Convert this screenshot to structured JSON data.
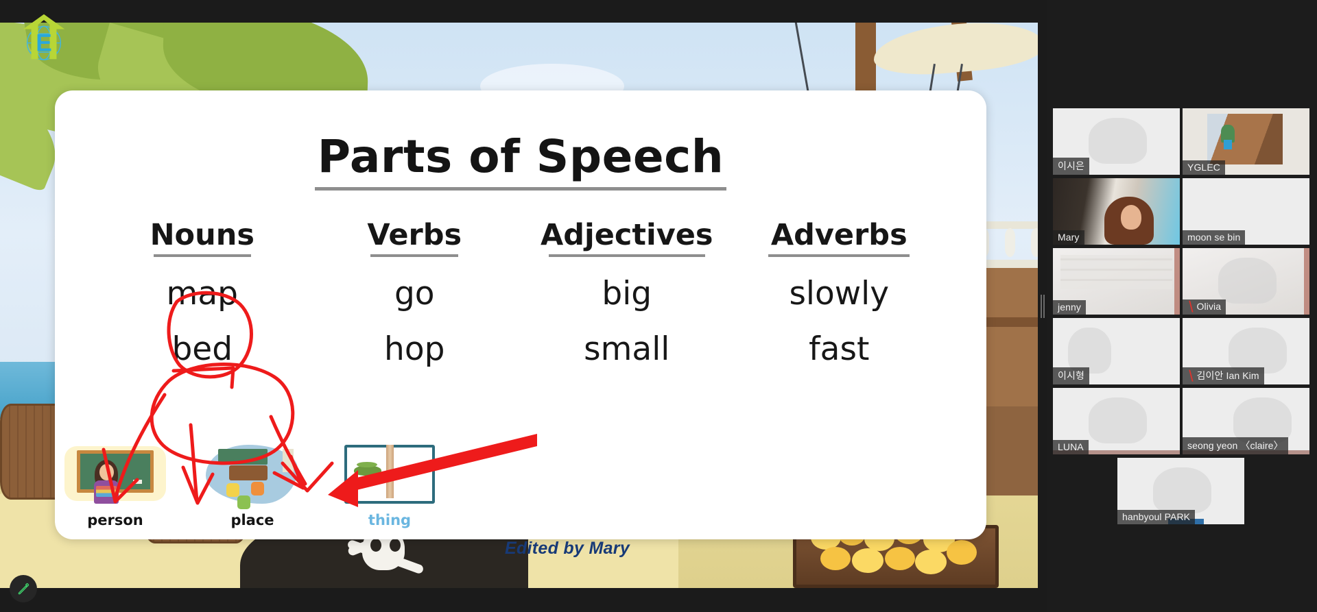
{
  "app": {
    "window_background": "#161616",
    "accent_active_speaker": "#b5e61d",
    "mute_icon_color": "#e0322b"
  },
  "logo": {
    "name": "eco-globe-arrow-logo",
    "letter": "E"
  },
  "annotation_toolbar": {
    "pencil_icon_label": "pencil-icon",
    "color": "#3fd16b"
  },
  "drag_handle": {
    "label": "resize-handle"
  },
  "slide": {
    "title": "Parts of Speech",
    "credit": "Edited by Mary",
    "columns": [
      {
        "header": "Nouns",
        "words": [
          "map",
          "bed"
        ]
      },
      {
        "header": "Verbs",
        "words": [
          "go",
          "hop"
        ]
      },
      {
        "header": "Adjectives",
        "words": [
          "big",
          "small"
        ]
      },
      {
        "header": "Adverbs",
        "words": [
          "slowly",
          "fast"
        ]
      }
    ],
    "pictures": [
      {
        "label": "person",
        "icon": "teacher-chalkboard-illustration",
        "label_color": "#141414"
      },
      {
        "label": "place",
        "icon": "classroom-illustration",
        "label_color": "#141414"
      },
      {
        "label": "thing",
        "icon": "open-book-caterpillar-illustration",
        "label_color": "#6ab6e0"
      }
    ],
    "background_scene": "pirate-beach-ship-treasure",
    "ink_annotations": {
      "color": "#ee1b1b",
      "marks": [
        "circle-around-map",
        "circle-around-bed",
        "arrow-from-map-to-person-image",
        "arrow-from-bed-to-place-image",
        "arrow-to-thing-image",
        "long-left-arrow"
      ]
    }
  },
  "video_panel": {
    "participants": [
      {
        "name": "이시은",
        "muted": false,
        "active_speaker": false,
        "video_on": true
      },
      {
        "name": "YGLEC",
        "muted": false,
        "active_speaker": false,
        "video_on": true
      },
      {
        "name": "Mary",
        "muted": false,
        "active_speaker": true,
        "video_on": true
      },
      {
        "name": "moon se bin",
        "muted": false,
        "active_speaker": false,
        "video_on": true
      },
      {
        "name": "jenny",
        "muted": false,
        "active_speaker": false,
        "video_on": true
      },
      {
        "name": "Olivia",
        "muted": true,
        "active_speaker": false,
        "video_on": true
      },
      {
        "name": "이시형",
        "muted": false,
        "active_speaker": false,
        "video_on": true
      },
      {
        "name": "김이안 Ian Kim",
        "muted": true,
        "active_speaker": false,
        "video_on": true
      },
      {
        "name": "LUNA",
        "muted": false,
        "active_speaker": false,
        "video_on": true
      },
      {
        "name": "seong yeon 〈claire〉",
        "muted": false,
        "active_speaker": false,
        "video_on": true
      },
      {
        "name": "hanbyoul PARK",
        "muted": false,
        "active_speaker": false,
        "video_on": true
      }
    ]
  }
}
